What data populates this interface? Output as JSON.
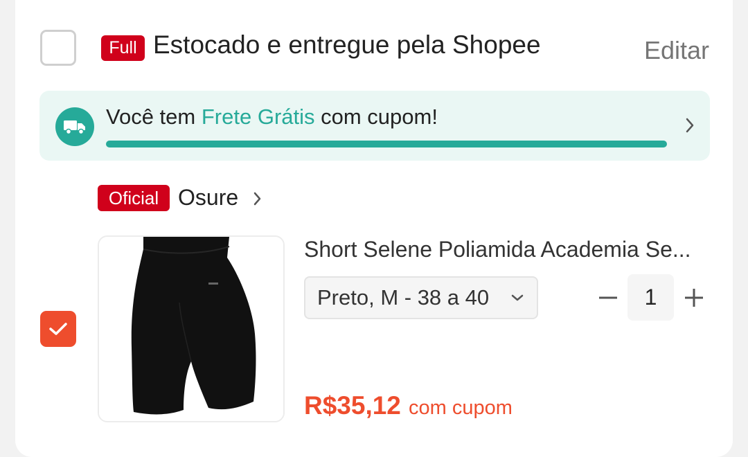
{
  "header": {
    "badge": "Full",
    "title": "Estocado e entregue pela Shopee",
    "edit_label": "Editar"
  },
  "promo": {
    "text_prefix": "Você tem ",
    "text_highlight": "Frete Grátis",
    "text_suffix": " com cupom!",
    "progress": 1.0
  },
  "shop": {
    "badge": "Oficial",
    "name": "Osure"
  },
  "item": {
    "title": "Short Selene Poliamida Academia Se...",
    "variant": "Preto, M - 38 a 40",
    "quantity": "1",
    "price": "R$35,12",
    "price_note": "com cupom",
    "checked": true
  },
  "colors": {
    "brand": "#ee4d2d",
    "badge_red": "#d0011b",
    "teal": "#26aa99"
  }
}
